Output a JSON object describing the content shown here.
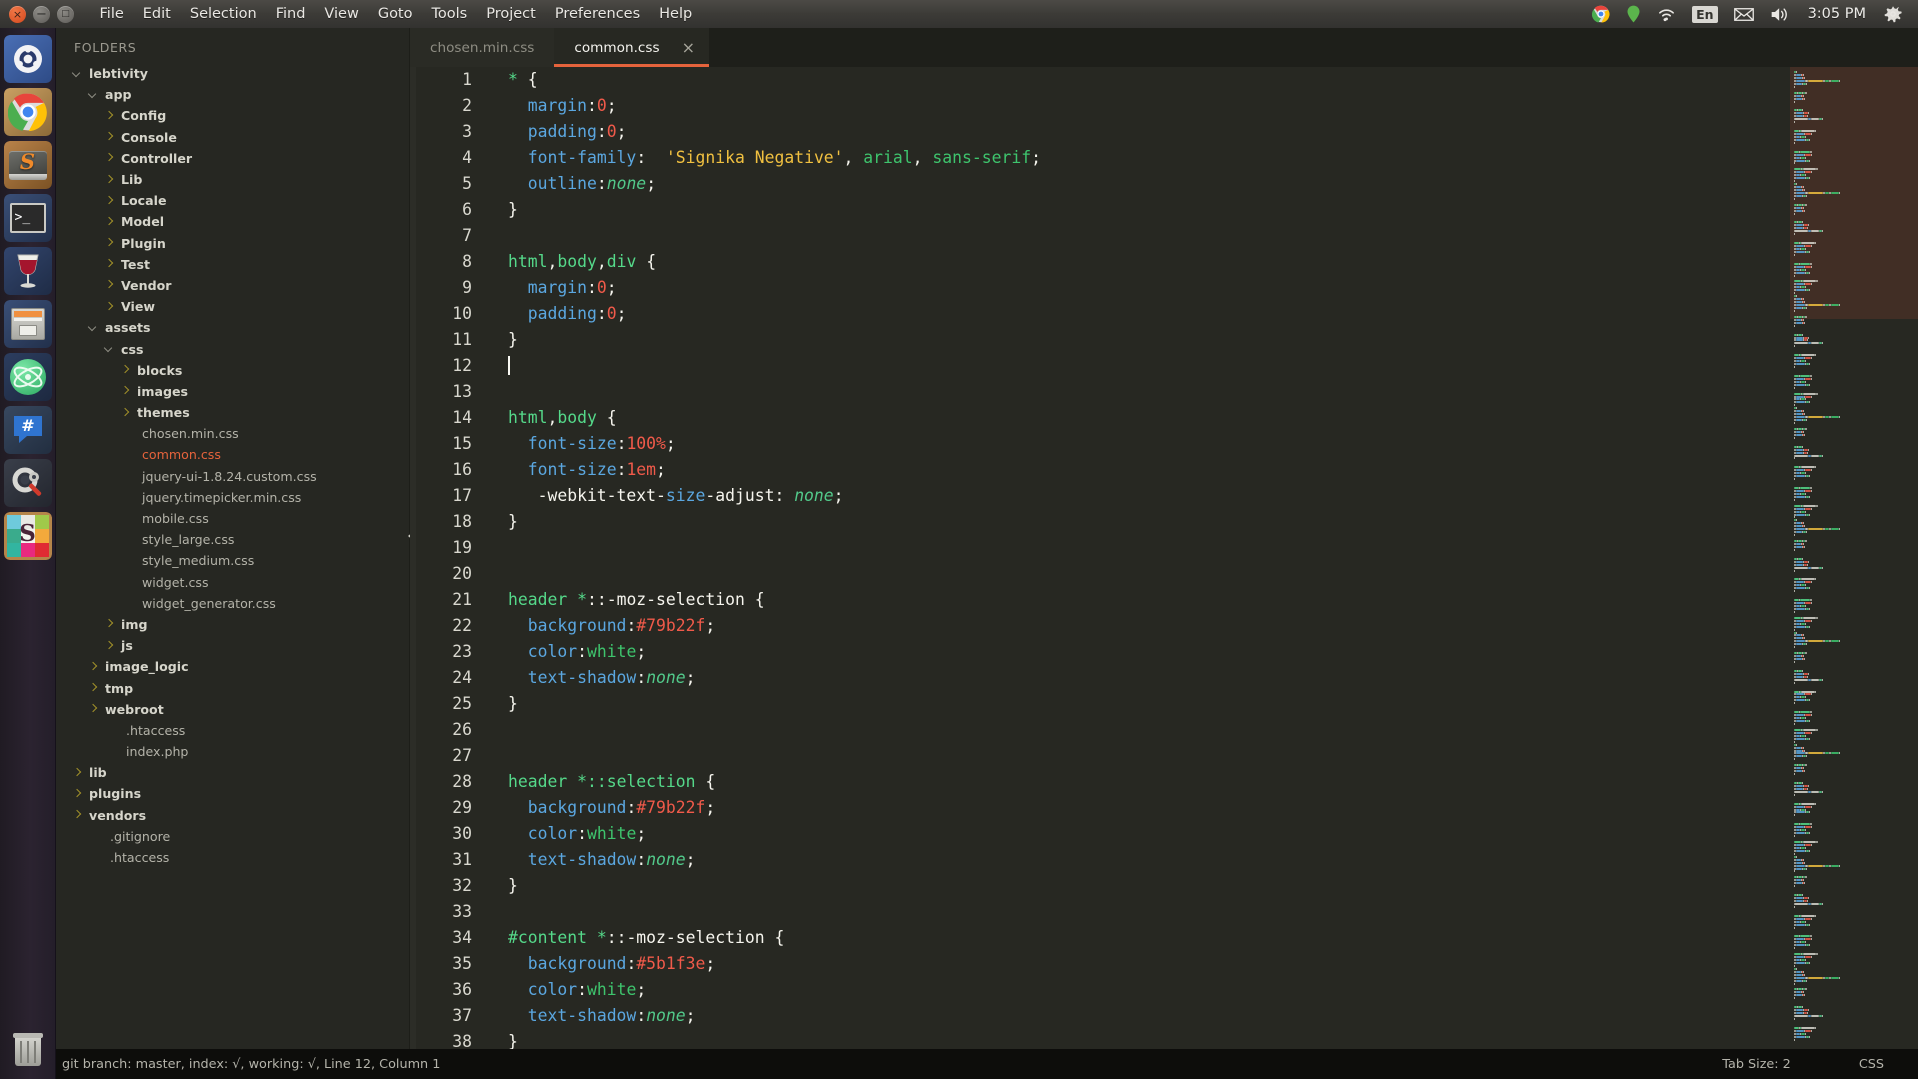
{
  "top_panel": {
    "window_controls": [
      {
        "name": "close",
        "glyph": "×"
      },
      {
        "name": "minimize",
        "glyph": "−"
      },
      {
        "name": "maximize",
        "glyph": "□"
      }
    ],
    "menu": [
      "File",
      "Edit",
      "Selection",
      "Find",
      "View",
      "Goto",
      "Tools",
      "Project",
      "Preferences",
      "Help"
    ],
    "tray": {
      "icons": [
        "chrome-icon",
        "location-pin-icon",
        "wifi-icon",
        "keyboard-layout-indicator",
        "mail-icon",
        "volume-icon",
        "system-gear-icon"
      ],
      "keyboard_layout": "En",
      "clock": "3:05 PM"
    }
  },
  "launcher": {
    "items": [
      {
        "name": "ubuntu-dash-icon",
        "label": "Dash"
      },
      {
        "name": "chrome-icon",
        "label": "Google Chrome"
      },
      {
        "name": "sublime-text-icon",
        "label": "Sublime Text",
        "running": true,
        "focused": true
      },
      {
        "name": "terminal-icon",
        "label": "Terminal"
      },
      {
        "name": "wine-icon",
        "label": "Wine"
      },
      {
        "name": "files-icon",
        "label": "Files"
      },
      {
        "name": "atom-icon",
        "label": "Atom"
      },
      {
        "name": "hipchat-icon",
        "label": "HipChat"
      },
      {
        "name": "system-settings-icon",
        "label": "System Settings"
      },
      {
        "name": "slack-icon",
        "label": "Slack",
        "running": true
      }
    ],
    "trash": {
      "name": "trash-icon",
      "label": "Trash"
    }
  },
  "sidebar": {
    "header": "FOLDERS",
    "tree": [
      {
        "label": "lebtivity",
        "type": "folder",
        "open": true,
        "depth": 0
      },
      {
        "label": "app",
        "type": "folder",
        "open": true,
        "depth": 1
      },
      {
        "label": "Config",
        "type": "folder",
        "open": false,
        "depth": 2
      },
      {
        "label": "Console",
        "type": "folder",
        "open": false,
        "depth": 2
      },
      {
        "label": "Controller",
        "type": "folder",
        "open": false,
        "depth": 2
      },
      {
        "label": "Lib",
        "type": "folder",
        "open": false,
        "depth": 2
      },
      {
        "label": "Locale",
        "type": "folder",
        "open": false,
        "depth": 2
      },
      {
        "label": "Model",
        "type": "folder",
        "open": false,
        "depth": 2
      },
      {
        "label": "Plugin",
        "type": "folder",
        "open": false,
        "depth": 2
      },
      {
        "label": "Test",
        "type": "folder",
        "open": false,
        "depth": 2
      },
      {
        "label": "Vendor",
        "type": "folder",
        "open": false,
        "depth": 2
      },
      {
        "label": "View",
        "type": "folder",
        "open": false,
        "depth": 2
      },
      {
        "label": "assets",
        "type": "folder",
        "open": true,
        "depth": 1
      },
      {
        "label": "css",
        "type": "folder",
        "open": true,
        "depth": 2
      },
      {
        "label": "blocks",
        "type": "folder",
        "open": false,
        "depth": 3
      },
      {
        "label": "images",
        "type": "folder",
        "open": false,
        "depth": 3
      },
      {
        "label": "themes",
        "type": "folder",
        "open": false,
        "depth": 3
      },
      {
        "label": "chosen.min.css",
        "type": "file",
        "depth": 3
      },
      {
        "label": "common.css",
        "type": "file",
        "depth": 3,
        "active": true
      },
      {
        "label": "jquery-ui-1.8.24.custom.css",
        "type": "file",
        "depth": 3
      },
      {
        "label": "jquery.timepicker.min.css",
        "type": "file",
        "depth": 3
      },
      {
        "label": "mobile.css",
        "type": "file",
        "depth": 3
      },
      {
        "label": "style_large.css",
        "type": "file",
        "depth": 3
      },
      {
        "label": "style_medium.css",
        "type": "file",
        "depth": 3
      },
      {
        "label": "widget.css",
        "type": "file",
        "depth": 3
      },
      {
        "label": "widget_generator.css",
        "type": "file",
        "depth": 3
      },
      {
        "label": "img",
        "type": "folder",
        "open": false,
        "depth": 2
      },
      {
        "label": "js",
        "type": "folder",
        "open": false,
        "depth": 2
      },
      {
        "label": "image_logic",
        "type": "folder",
        "open": false,
        "depth": 1
      },
      {
        "label": "tmp",
        "type": "folder",
        "open": false,
        "depth": 1
      },
      {
        "label": "webroot",
        "type": "folder",
        "open": false,
        "depth": 1
      },
      {
        "label": ".htaccess",
        "type": "file",
        "depth": 2
      },
      {
        "label": "index.php",
        "type": "file",
        "depth": 2
      },
      {
        "label": "lib",
        "type": "folder",
        "open": false,
        "depth": 0
      },
      {
        "label": "plugins",
        "type": "folder",
        "open": false,
        "depth": 0
      },
      {
        "label": "vendors",
        "type": "folder",
        "open": false,
        "depth": 0
      },
      {
        "label": ".gitignore",
        "type": "file",
        "depth": 1
      },
      {
        "label": ".htaccess",
        "type": "file",
        "depth": 1
      }
    ]
  },
  "tabs": [
    {
      "label": "chosen.min.css",
      "active": false,
      "closable": false
    },
    {
      "label": "common.css",
      "active": true,
      "closable": true,
      "close_glyph": "×"
    }
  ],
  "editor": {
    "language": "CSS",
    "cursor_line": 12,
    "cursor_column": 1,
    "lines": [
      {
        "n": 1,
        "tokens": [
          {
            "t": "* ",
            "c": "sel"
          },
          {
            "t": "{",
            "c": "pn"
          }
        ]
      },
      {
        "n": 2,
        "tokens": [
          {
            "t": "  ",
            "c": "pl"
          },
          {
            "t": "margin",
            "c": "prop"
          },
          {
            "t": ":",
            "c": "pn"
          },
          {
            "t": "0",
            "c": "num"
          },
          {
            "t": ";",
            "c": "pn"
          }
        ]
      },
      {
        "n": 3,
        "tokens": [
          {
            "t": "  ",
            "c": "pl"
          },
          {
            "t": "padding",
            "c": "prop"
          },
          {
            "t": ":",
            "c": "pn"
          },
          {
            "t": "0",
            "c": "num"
          },
          {
            "t": ";",
            "c": "pn"
          }
        ]
      },
      {
        "n": 4,
        "tokens": [
          {
            "t": "  ",
            "c": "pl"
          },
          {
            "t": "font-family",
            "c": "prop"
          },
          {
            "t": ":  ",
            "c": "pn"
          },
          {
            "t": "'Signika Negative'",
            "c": "str"
          },
          {
            "t": ", ",
            "c": "pn"
          },
          {
            "t": "arial",
            "c": "kw2"
          },
          {
            "t": ", ",
            "c": "pn"
          },
          {
            "t": "sans-serif",
            "c": "kw2"
          },
          {
            "t": ";",
            "c": "pn"
          }
        ]
      },
      {
        "n": 5,
        "tokens": [
          {
            "t": "  ",
            "c": "pl"
          },
          {
            "t": "outline",
            "c": "prop"
          },
          {
            "t": ":",
            "c": "pn"
          },
          {
            "t": "none",
            "c": "kw"
          },
          {
            "t": ";",
            "c": "pn"
          }
        ]
      },
      {
        "n": 6,
        "tokens": [
          {
            "t": "}",
            "c": "pn"
          }
        ]
      },
      {
        "n": 7,
        "tokens": []
      },
      {
        "n": 8,
        "tokens": [
          {
            "t": "html",
            "c": "sel"
          },
          {
            "t": ",",
            "c": "pn"
          },
          {
            "t": "body",
            "c": "sel"
          },
          {
            "t": ",",
            "c": "pn"
          },
          {
            "t": "div",
            "c": "sel"
          },
          {
            "t": " {",
            "c": "pn"
          }
        ]
      },
      {
        "n": 9,
        "tokens": [
          {
            "t": "  ",
            "c": "pl"
          },
          {
            "t": "margin",
            "c": "prop"
          },
          {
            "t": ":",
            "c": "pn"
          },
          {
            "t": "0",
            "c": "num"
          },
          {
            "t": ";",
            "c": "pn"
          }
        ]
      },
      {
        "n": 10,
        "tokens": [
          {
            "t": "  ",
            "c": "pl"
          },
          {
            "t": "padding",
            "c": "prop"
          },
          {
            "t": ":",
            "c": "pn"
          },
          {
            "t": "0",
            "c": "num"
          },
          {
            "t": ";",
            "c": "pn"
          }
        ]
      },
      {
        "n": 11,
        "tokens": [
          {
            "t": "}",
            "c": "pn"
          }
        ]
      },
      {
        "n": 12,
        "tokens": [],
        "caret": true
      },
      {
        "n": 13,
        "tokens": []
      },
      {
        "n": 14,
        "tokens": [
          {
            "t": "html",
            "c": "sel"
          },
          {
            "t": ",",
            "c": "pn"
          },
          {
            "t": "body",
            "c": "sel"
          },
          {
            "t": " {",
            "c": "pn"
          }
        ]
      },
      {
        "n": 15,
        "tokens": [
          {
            "t": "  ",
            "c": "pl"
          },
          {
            "t": "font-size",
            "c": "prop"
          },
          {
            "t": ":",
            "c": "pn"
          },
          {
            "t": "100%",
            "c": "num"
          },
          {
            "t": ";",
            "c": "pn"
          }
        ]
      },
      {
        "n": 16,
        "tokens": [
          {
            "t": "  ",
            "c": "pl"
          },
          {
            "t": "font-size",
            "c": "prop"
          },
          {
            "t": ":",
            "c": "pn"
          },
          {
            "t": "1em",
            "c": "num"
          },
          {
            "t": ";",
            "c": "pn"
          }
        ]
      },
      {
        "n": 17,
        "tokens": [
          {
            "t": "   -webkit-text-",
            "c": "pl"
          },
          {
            "t": "size",
            "c": "prop"
          },
          {
            "t": "-adjust: ",
            "c": "pl"
          },
          {
            "t": "none",
            "c": "kw"
          },
          {
            "t": ";",
            "c": "pn"
          }
        ]
      },
      {
        "n": 18,
        "tokens": [
          {
            "t": "}",
            "c": "pn"
          }
        ]
      },
      {
        "n": 19,
        "tokens": []
      },
      {
        "n": 20,
        "tokens": []
      },
      {
        "n": 21,
        "tokens": [
          {
            "t": "header",
            "c": "sel"
          },
          {
            "t": " ",
            "c": "pl"
          },
          {
            "t": "*",
            "c": "sel"
          },
          {
            "t": "::-moz-selection",
            "c": "pl"
          },
          {
            "t": " {",
            "c": "pn"
          }
        ]
      },
      {
        "n": 22,
        "tokens": [
          {
            "t": "  ",
            "c": "pl"
          },
          {
            "t": "background",
            "c": "prop"
          },
          {
            "t": ":",
            "c": "pn"
          },
          {
            "t": "#79b22f",
            "c": "num"
          },
          {
            "t": ";",
            "c": "pn"
          }
        ]
      },
      {
        "n": 23,
        "tokens": [
          {
            "t": "  ",
            "c": "pl"
          },
          {
            "t": "color",
            "c": "prop"
          },
          {
            "t": ":",
            "c": "pn"
          },
          {
            "t": "white",
            "c": "kw2"
          },
          {
            "t": ";",
            "c": "pn"
          }
        ]
      },
      {
        "n": 24,
        "tokens": [
          {
            "t": "  ",
            "c": "pl"
          },
          {
            "t": "text-shadow",
            "c": "prop"
          },
          {
            "t": ":",
            "c": "pn"
          },
          {
            "t": "none",
            "c": "kw"
          },
          {
            "t": ";",
            "c": "pn"
          }
        ]
      },
      {
        "n": 25,
        "tokens": [
          {
            "t": "}",
            "c": "pn"
          }
        ]
      },
      {
        "n": 26,
        "tokens": []
      },
      {
        "n": 27,
        "tokens": []
      },
      {
        "n": 28,
        "tokens": [
          {
            "t": "header",
            "c": "sel"
          },
          {
            "t": " ",
            "c": "pl"
          },
          {
            "t": "*::selection",
            "c": "sel"
          },
          {
            "t": " {",
            "c": "pn"
          }
        ]
      },
      {
        "n": 29,
        "tokens": [
          {
            "t": "  ",
            "c": "pl"
          },
          {
            "t": "background",
            "c": "prop"
          },
          {
            "t": ":",
            "c": "pn"
          },
          {
            "t": "#79b22f",
            "c": "num"
          },
          {
            "t": ";",
            "c": "pn"
          }
        ]
      },
      {
        "n": 30,
        "tokens": [
          {
            "t": "  ",
            "c": "pl"
          },
          {
            "t": "color",
            "c": "prop"
          },
          {
            "t": ":",
            "c": "pn"
          },
          {
            "t": "white",
            "c": "kw2"
          },
          {
            "t": ";",
            "c": "pn"
          }
        ]
      },
      {
        "n": 31,
        "tokens": [
          {
            "t": "  ",
            "c": "pl"
          },
          {
            "t": "text-shadow",
            "c": "prop"
          },
          {
            "t": ":",
            "c": "pn"
          },
          {
            "t": "none",
            "c": "kw"
          },
          {
            "t": ";",
            "c": "pn"
          }
        ]
      },
      {
        "n": 32,
        "tokens": [
          {
            "t": "}",
            "c": "pn"
          }
        ]
      },
      {
        "n": 33,
        "tokens": []
      },
      {
        "n": 34,
        "tokens": [
          {
            "t": "#content",
            "c": "sel"
          },
          {
            "t": " ",
            "c": "pl"
          },
          {
            "t": "*",
            "c": "sel"
          },
          {
            "t": "::-moz-selection",
            "c": "pl"
          },
          {
            "t": " {",
            "c": "pn"
          }
        ]
      },
      {
        "n": 35,
        "tokens": [
          {
            "t": "  ",
            "c": "pl"
          },
          {
            "t": "background",
            "c": "prop"
          },
          {
            "t": ":",
            "c": "pn"
          },
          {
            "t": "#5b1f3e",
            "c": "num"
          },
          {
            "t": ";",
            "c": "pn"
          }
        ]
      },
      {
        "n": 36,
        "tokens": [
          {
            "t": "  ",
            "c": "pl"
          },
          {
            "t": "color",
            "c": "prop"
          },
          {
            "t": ":",
            "c": "pn"
          },
          {
            "t": "white",
            "c": "kw2"
          },
          {
            "t": ";",
            "c": "pn"
          }
        ]
      },
      {
        "n": 37,
        "tokens": [
          {
            "t": "  ",
            "c": "pl"
          },
          {
            "t": "text-shadow",
            "c": "prop"
          },
          {
            "t": ":",
            "c": "pn"
          },
          {
            "t": "none",
            "c": "kw"
          },
          {
            "t": ";",
            "c": "pn"
          }
        ]
      },
      {
        "n": 38,
        "tokens": [
          {
            "t": "}",
            "c": "pn"
          }
        ]
      }
    ]
  },
  "statusbar": {
    "git_status": "git branch: master, index: √, working: √, Line 12, Column 1",
    "tab_size": "Tab Size: 2",
    "syntax": "CSS"
  },
  "colors": {
    "accent": "#e5633c",
    "editor_bg": "#272822",
    "sidebar_bg": "#262722",
    "panel_bg": "#3c3b37",
    "selector_green": "#55d98a",
    "property_blue": "#5ba7e0",
    "number_red": "#f05a4a",
    "string_yellow": "#f0c040"
  }
}
